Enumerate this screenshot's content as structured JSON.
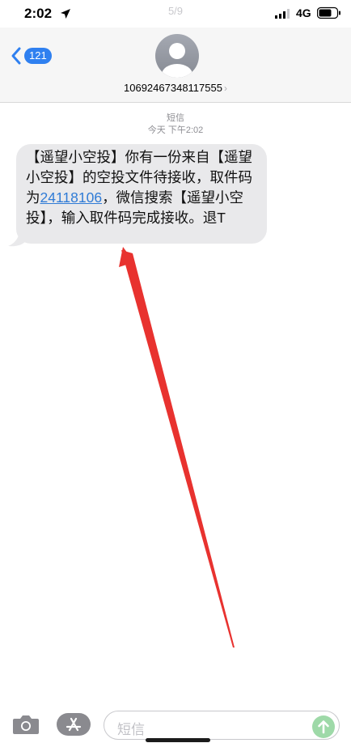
{
  "status_bar": {
    "time": "2:02",
    "page_indicator": "5/9",
    "network": "4G",
    "icons": [
      "location-arrow-icon",
      "signal-icon",
      "battery-icon"
    ]
  },
  "header": {
    "back_badge": "121",
    "contact": "10692467348117555",
    "icons": [
      "back-chevron-icon",
      "avatar-icon",
      "chevron-right-icon"
    ]
  },
  "thread": {
    "service_label": "短信",
    "timestamp": "今天 下午2:02",
    "message": {
      "text_before": "【遥望小空投】你有一份来自【遥望小空投】的空投文件待接收，取件码为",
      "code_link": "24118106",
      "text_after": "，微信搜索【遥望小空投】，输入取件码完成接收。退T"
    }
  },
  "input_bar": {
    "placeholder": "短信",
    "icons": [
      "camera-icon",
      "app-store-icon",
      "send-arrow-icon"
    ]
  },
  "colors": {
    "accent": "#2F80F0",
    "bubble": "#E9E9EB",
    "annotation_arrow": "#E8322F",
    "send": "#9ED9A8"
  }
}
